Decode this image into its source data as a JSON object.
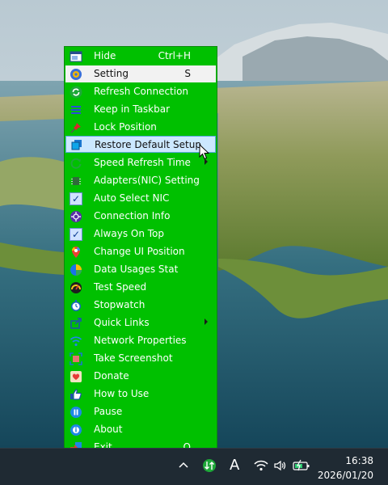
{
  "menu": {
    "items": [
      {
        "label": "Hide",
        "shortcut": "Ctrl+H",
        "icon": "window-icon"
      },
      {
        "label": "Setting",
        "shortcut": "S",
        "icon": "gear-icon"
      },
      {
        "label": "Refresh Connection",
        "icon": "refresh-icon"
      },
      {
        "label": "Keep in Taskbar",
        "icon": "hamburger-icon"
      },
      {
        "label": "Lock Position",
        "icon": "pin-icon"
      },
      {
        "label": "Restore Default Setup",
        "icon": "restore-icon"
      },
      {
        "label": "Speed Refresh Time",
        "icon": "speed-refresh-icon",
        "submenu": true
      },
      {
        "label": "Adapters(NIC) Setting",
        "icon": "network-adapter-icon"
      },
      {
        "label": "Auto Select NIC",
        "icon": "checkbox-icon",
        "checked": true
      },
      {
        "label": "Connection Info",
        "icon": "connection-info-icon"
      },
      {
        "label": "Always On Top",
        "icon": "checkbox-icon",
        "checked": true
      },
      {
        "label": "Change UI Position",
        "icon": "location-pin-icon"
      },
      {
        "label": "Data Usages Stat",
        "icon": "pie-chart-icon"
      },
      {
        "label": "Test Speed",
        "icon": "speedometer-icon"
      },
      {
        "label": "Stopwatch",
        "icon": "stopwatch-icon"
      },
      {
        "label": "Quick Links",
        "icon": "share-icon",
        "submenu": true
      },
      {
        "label": "Network Properties",
        "icon": "wifi-icon"
      },
      {
        "label": "Take Screenshot",
        "icon": "screenshot-icon"
      },
      {
        "label": "Donate",
        "icon": "donate-icon"
      },
      {
        "label": "How to Use",
        "icon": "thumbs-up-icon"
      },
      {
        "label": "Pause",
        "icon": "pause-icon"
      },
      {
        "label": "About",
        "icon": "info-icon"
      },
      {
        "label": "Exit",
        "shortcut": "Q",
        "icon": "exit-icon"
      }
    ]
  },
  "taskbar": {
    "ime_label": "A",
    "time": "16:38",
    "date": "2026/01/20"
  }
}
